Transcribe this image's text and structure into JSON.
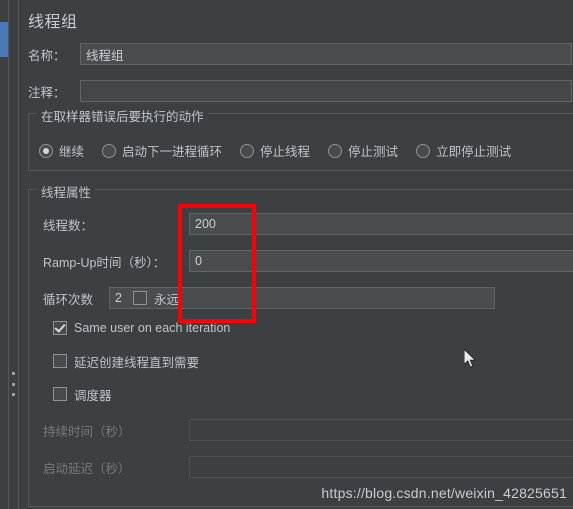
{
  "window": {
    "panel_title": "线程组"
  },
  "fields": {
    "name_label": "名称：",
    "name_value": "线程组",
    "comment_label": "注释：",
    "comment_value": "",
    "comment_placeholder": ""
  },
  "error_action": {
    "group_title": "在取样器错误后要执行的动作",
    "options": [
      {
        "label": "继续",
        "selected": true
      },
      {
        "label": "启动下一进程循环",
        "selected": false
      },
      {
        "label": "停止线程",
        "selected": false
      },
      {
        "label": "停止测试",
        "selected": false
      },
      {
        "label": "立即停止测试",
        "selected": false
      }
    ]
  },
  "thread_properties": {
    "group_title": "线程属性",
    "threads_label": "线程数：",
    "threads_value": "200",
    "ramp_up_label": "Ramp-Up时间（秒）：",
    "ramp_up_value": "0",
    "loops_label": "循环次数",
    "loops_value": "2",
    "forever_label": "永远",
    "forever_checked": false,
    "same_user_label": "Same user on each iteration",
    "same_user_checked": true,
    "delay_create_label": "延迟创建线程直到需要",
    "delay_create_checked": false,
    "scheduler_label": "调度器",
    "scheduler_checked": false,
    "duration_label": "持续时间（秒）",
    "duration_value": "",
    "startup_delay_label": "启动延迟（秒）",
    "startup_delay_value": ""
  },
  "annotation": {
    "color": "#fb0006"
  },
  "watermark": {
    "text": "https://blog.csdn.net/weixin_42825651"
  },
  "theme": {
    "background": "#3c4043",
    "field_background": "#494d50",
    "border": "#55595c",
    "text": "#bfc4c8",
    "selection_blue": "#4a7ab5"
  }
}
